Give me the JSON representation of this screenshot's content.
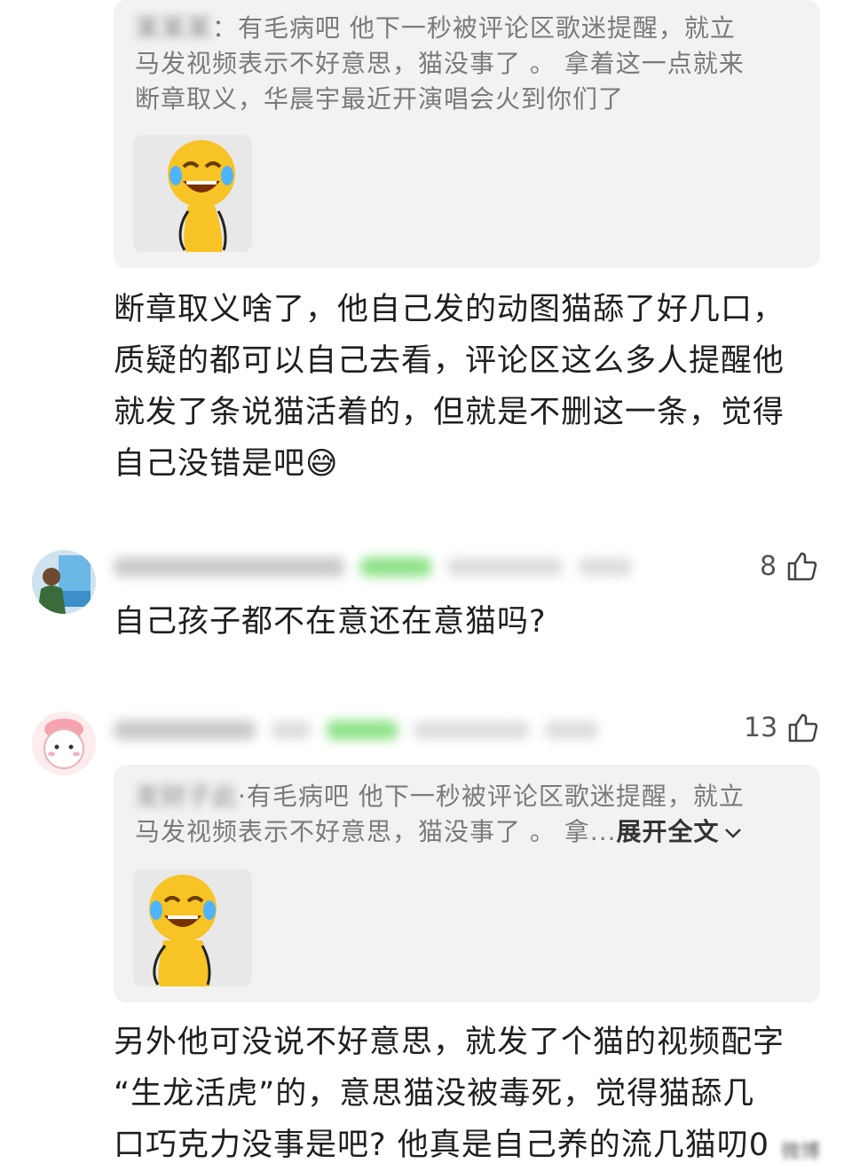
{
  "comment1": {
    "quote": {
      "author": "某某某",
      "text_line1": "有毛病吧 他下一秒被评论区歌迷提醒，就立",
      "text_line2": "马发视频表示不好意思，猫没事了 。 拿着这一点就来",
      "text_line3": "断章取义，华晨宇最近开演唱会火到你们了"
    },
    "body_line1": "断章取义啥了，他自己发的动图猫舔了好几口，",
    "body_line2": "质疑的都可以自己去看，评论区这么多人提醒他",
    "body_line3": "就发了条说猫活着的，但就是不删这一条，觉得",
    "body_line4": "自己没错是吧",
    "emoji": "😅"
  },
  "comment2": {
    "like_count": "8",
    "text": "自己孩子都不在意还在意猫吗?"
  },
  "comment3": {
    "like_count": "13",
    "quote": {
      "author": "发财子此",
      "text_line1": "有毛病吧 他下一秒被评论区歌迷提醒，就立",
      "text_line2": "马发视频表示不好意思，猫没事了 。 拿...",
      "expand_label": "展开全文"
    },
    "body_line1": "另外他可没说不好意思，就发了个猫的视频配字",
    "body_line2": "“生龙活虎”的，意思猫没被毒死，觉得猫舔几",
    "body_line3": "口巧克力没事是吧? 他真是自己养的流几猫叨0",
    "watermark": "微博"
  },
  "colors": {
    "quote_bg": "#f2f2f2",
    "badge_green": "#8fe38a",
    "sticker_yellow": "#f7c325"
  },
  "icons": [
    "thumbs-up-icon",
    "chevron-down-icon",
    "laughing-tears-sticker"
  ]
}
